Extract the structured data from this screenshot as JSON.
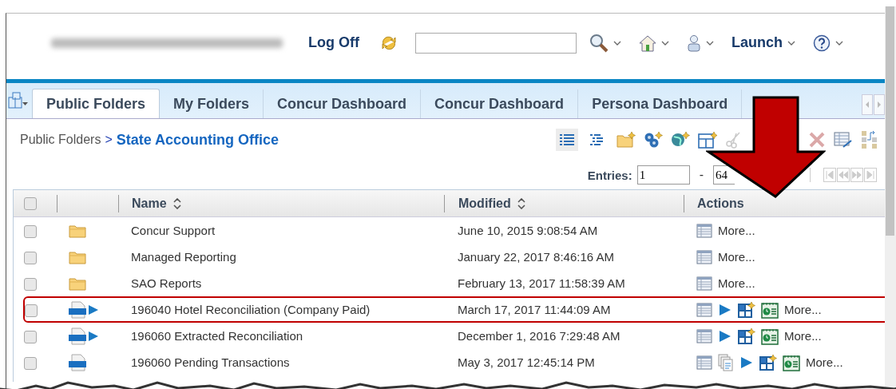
{
  "header": {
    "log_off": "Log Off",
    "launch": "Launch"
  },
  "tabs": [
    {
      "label": "Public Folders",
      "selected": true
    },
    {
      "label": "My Folders",
      "selected": false
    },
    {
      "label": "Concur Dashboard",
      "selected": false
    },
    {
      "label": "Concur Dashboard",
      "selected": false
    },
    {
      "label": "Persona Dashboard",
      "selected": false
    }
  ],
  "breadcrumb": {
    "parent": "Public Folders",
    "separator": ">",
    "current": "State Accounting Office"
  },
  "select_all": {
    "checked": false
  },
  "views": [
    {
      "selected": true
    },
    {
      "selected": false
    }
  ],
  "paging": {
    "label": "Entries:",
    "from": "1",
    "separator": "-",
    "to": "64"
  },
  "table": {
    "columns": [
      "Name",
      "Modified",
      "Actions"
    ],
    "rows": [
      {
        "kind": "folder",
        "checked": false,
        "highlighted": false,
        "name": "Concur Support",
        "modified": "June 10, 2015 9:08:54 AM",
        "actions": [
          {
            "kind": "properties"
          }
        ],
        "more": "More..."
      },
      {
        "kind": "folder",
        "checked": false,
        "highlighted": false,
        "name": "Managed Reporting",
        "modified": "January 22, 2017 8:46:16 AM",
        "actions": [
          {
            "kind": "properties"
          }
        ],
        "more": "More..."
      },
      {
        "kind": "folder",
        "checked": false,
        "highlighted": false,
        "name": "SAO Reports",
        "modified": "February 13, 2017 11:58:39 AM",
        "actions": [
          {
            "kind": "properties"
          }
        ],
        "more": "More..."
      },
      {
        "kind": "html-run",
        "checked": false,
        "highlighted": true,
        "name": "196040 Hotel Reconciliation (Company Paid)",
        "modified": "March 17, 2017 11:44:09 AM",
        "actions": [
          {
            "kind": "properties"
          },
          {
            "kind": "run"
          },
          {
            "kind": "new"
          },
          {
            "kind": "schedule"
          }
        ],
        "more": "More..."
      },
      {
        "kind": "html-run",
        "checked": false,
        "highlighted": false,
        "name": "196060 Extracted Reconciliation",
        "modified": "December 1, 2016 7:29:48 AM",
        "actions": [
          {
            "kind": "properties"
          },
          {
            "kind": "run"
          },
          {
            "kind": "new"
          },
          {
            "kind": "schedule"
          }
        ],
        "more": "More..."
      },
      {
        "kind": "html",
        "checked": false,
        "highlighted": false,
        "name": "196060 Pending Transactions",
        "modified": "May 3, 2017 12:45:14 PM",
        "actions": [
          {
            "kind": "properties"
          },
          {
            "kind": "copies"
          },
          {
            "kind": "run"
          },
          {
            "kind": "new"
          },
          {
            "kind": "schedule"
          }
        ],
        "more": "More..."
      }
    ]
  }
}
